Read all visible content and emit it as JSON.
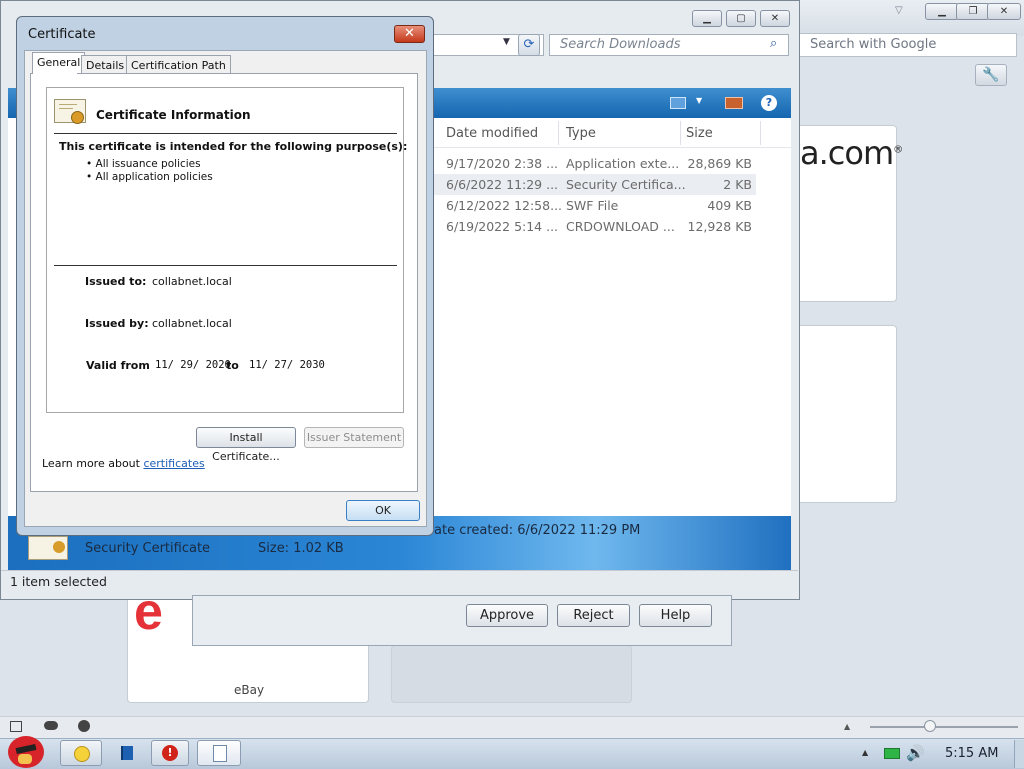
{
  "browser": {
    "google_search_placeholder": "Search with Google",
    "tiles": [
      {
        "label": "eBay"
      },
      {
        "label": ""
      }
    ],
    "partial_logo_text": "a.com",
    "partial_logo_mark": "®"
  },
  "explorer": {
    "search_placeholder": "Search Downloads",
    "columns": [
      "Date modified",
      "Type",
      "Size"
    ],
    "rows": [
      {
        "date": "9/17/2020 2:38 ...",
        "type": "Application exte...",
        "size": "28,869 KB"
      },
      {
        "date": "6/6/2022 11:29 ...",
        "type": "Security Certifica...",
        "size": "2 KB"
      },
      {
        "date": "6/12/2022 12:58...",
        "type": "SWF File",
        "size": "409 KB"
      },
      {
        "date": "6/19/2022 5:14 ...",
        "type": "CRDOWNLOAD ...",
        "size": "12,928 KB"
      }
    ],
    "details": {
      "name": "Security Certificate",
      "size": "Size: 1.02 KB",
      "date_created": "ate created: 6/6/2022 11:29 PM"
    },
    "status": "1 item selected"
  },
  "prompt": {
    "approve": "Approve",
    "reject": "Reject",
    "help": "Help"
  },
  "certificate": {
    "title": "Certificate",
    "close_glyph": "✕",
    "tabs": [
      "General",
      "Details",
      "Certification Path"
    ],
    "heading": "Certificate Information",
    "purpose_heading": "This certificate is intended for the following purpose(s):",
    "purposes": [
      "• All issuance policies",
      "• All application policies"
    ],
    "issued_to_label": "Issued to:",
    "issued_to": "collabnet.local",
    "issued_by_label": "Issued by:",
    "issued_by": "collabnet.local",
    "valid_from_label": "Valid from",
    "valid_from": "11/ 29/ 2020",
    "to_label": "to",
    "valid_to": "11/ 27/ 2030",
    "install_button": "Install Certificate...",
    "issuer_statement_button": "Issuer Statement",
    "learn_more": "Learn more about ",
    "learn_more_link": "certificates",
    "ok_button": "OK"
  },
  "taskbar": {
    "clock": "5:15 AM"
  }
}
